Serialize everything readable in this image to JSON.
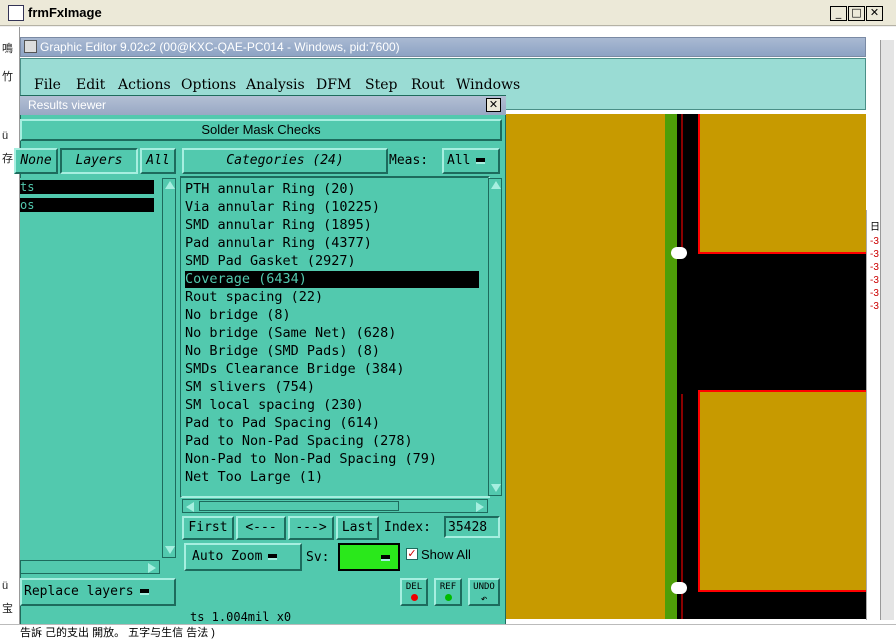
{
  "outer_window": {
    "title": "frmFxImage",
    "min_glyph": "_",
    "max_glyph": "□",
    "close_glyph": "✕",
    "left_strip_chars": [
      "鳴",
      "竹",
      "ü",
      "存",
      "宝",
      "ü"
    ],
    "right_strip_chars": [
      "日",
      "-3",
      "-3",
      "-3",
      "-3",
      "-3",
      "-3"
    ],
    "bottom_text": "告訴 己的支出 開放。 五字与生信 告法 )"
  },
  "graphic_editor": {
    "title": "Graphic Editor 9.02c2 (00@KXC-QAE-PC014 - Windows, pid:7600)",
    "menu": [
      "File",
      "Edit",
      "Actions",
      "Options",
      "Analysis",
      "DFM",
      "Step",
      "Rout",
      "Windows"
    ]
  },
  "results_viewer": {
    "title": "Results viewer",
    "close_glyph": "✕",
    "header": "Solder Mask Checks",
    "none_label": "None",
    "layers_label": "Layers",
    "all_label": "All",
    "categories_label": "Categories (24)",
    "meas_label": "Meas:",
    "meas_value": "All",
    "layers": [
      "ts",
      "os"
    ],
    "categories": [
      "PTH annular Ring (20)",
      "Via annular Ring (10225)",
      "SMD annular Ring (1895)",
      "Pad annular Ring (4377)",
      "SMD Pad Gasket (2927)",
      "Coverage (6434)",
      "Rout spacing (22)",
      "No bridge (8)",
      "No bridge (Same Net) (628)",
      "No Bridge (SMD Pads) (8)",
      "SMDs Clearance Bridge (384)",
      "SM slivers (754)",
      "SM local spacing (230)",
      "Pad to Pad Spacing (614)",
      "Pad to Non-Pad Spacing (278)",
      "Non-Pad to Non-Pad Spacing (79)",
      "Net Too Large (1)"
    ],
    "selected_category": "Coverage (6434)",
    "nav": {
      "first": "First",
      "prev": "<---",
      "next": "--->",
      "last": "Last",
      "index_label": "Index:",
      "index_value": "35428"
    },
    "auto_zoom": "Auto Zoom",
    "sv_label": "Sv:",
    "show_all_label": "Show All",
    "show_all_checked": true,
    "replace_layers": "Replace layers",
    "tools": [
      "DEL",
      "REF",
      "UNDO"
    ],
    "status_text": "ts 1.004mil x0"
  },
  "colors": {
    "panel": "#52c9ae",
    "menubar": "#9adcd4",
    "copper": "#c79a00",
    "green_strip": "#4e9e08",
    "pad_outline": "#ff0000",
    "sv_swatch": "#2ae81b"
  }
}
